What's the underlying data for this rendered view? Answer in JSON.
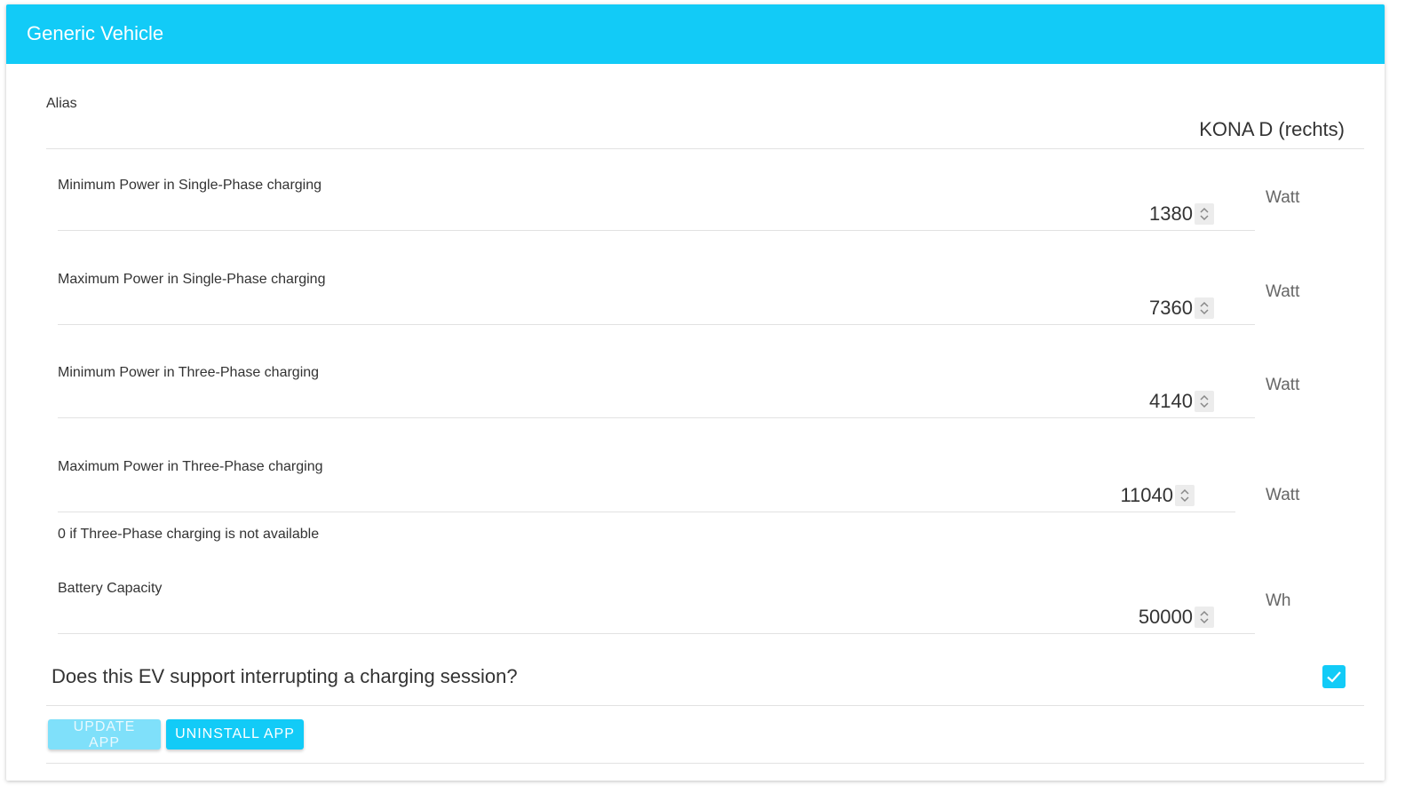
{
  "header": {
    "title": "Generic Vehicle"
  },
  "alias": {
    "label": "Alias",
    "value": "KONA D (rechts)"
  },
  "fields": [
    {
      "label": "Minimum Power in Single-Phase charging",
      "value": "1380",
      "unit": "Watt"
    },
    {
      "label": "Maximum Power in Single-Phase charging",
      "value": "7360",
      "unit": "Watt"
    },
    {
      "label": "Minimum Power in Three-Phase charging",
      "value": "4140",
      "unit": "Watt"
    },
    {
      "label": "Maximum Power in Three-Phase charging",
      "value": "11040",
      "unit": "Watt",
      "hint": "0 if Three-Phase charging is not available"
    },
    {
      "label": "Battery Capacity",
      "value": "50000",
      "unit": "Wh"
    }
  ],
  "interrupt": {
    "question": "Does this EV support interrupting a charging session?",
    "checked": true
  },
  "buttons": {
    "update": "UPDATE APP",
    "uninstall": "UNINSTALL APP"
  },
  "colors": {
    "accent": "#12cbf7",
    "accent_disabled": "#7fe0fa"
  }
}
